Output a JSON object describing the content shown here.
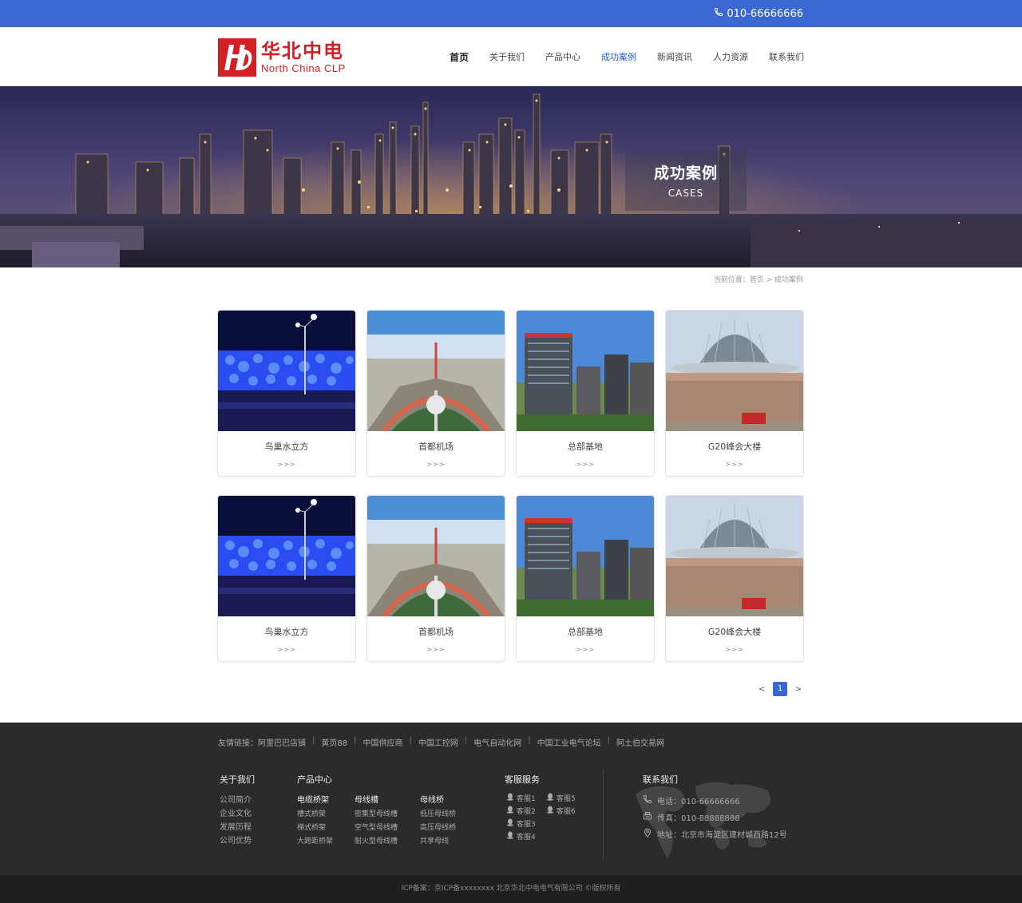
{
  "topbar": {
    "phone": "010-66666666",
    "phone_icon": "phone-icon"
  },
  "header": {
    "logo_cn": "华北中电",
    "logo_en": "North China CLP",
    "nav": [
      "首页",
      "关于我们",
      "产品中心",
      "成功案例",
      "新闻资讯",
      "人力资源",
      "联系我们"
    ]
  },
  "banner": {
    "title": "成功案例",
    "subtitle": "CASES"
  },
  "breadcrumb": {
    "text": "当前位置：首页 > 成功案例"
  },
  "cases": [
    {
      "name": "鸟巢水立方",
      "more": ">>>"
    },
    {
      "name": "首都机场",
      "more": ">>>"
    },
    {
      "name": "总部基地",
      "more": ">>>"
    },
    {
      "name": "G20峰会大楼",
      "more": ">>>"
    },
    {
      "name": "鸟巢水立方",
      "more": ">>>"
    },
    {
      "name": "首都机场",
      "more": ">>>"
    },
    {
      "name": "总部基地",
      "more": ">>>"
    },
    {
      "name": "G20峰会大楼",
      "more": ">>>"
    }
  ],
  "pager": {
    "prev": "<",
    "current": "1",
    "next": ">"
  },
  "footer": {
    "links_label": "友情链接：",
    "links": [
      "阿里巴巴店铺",
      "黄页88",
      "中国供应商",
      "中国工控网",
      "电气自动化网",
      "中国工业电气论坛",
      "阿土伯交易网"
    ],
    "about": {
      "title": "关于我们",
      "items": [
        "公司简介",
        "企业文化",
        "发展历程",
        "公司优势"
      ]
    },
    "products": {
      "title": "产品中心",
      "groups": [
        {
          "title": "电缆桥架",
          "items": [
            "槽式桥架",
            "梯式桥架",
            "大跨距桥架"
          ]
        },
        {
          "title": "母线槽",
          "items": [
            "密集型母线槽",
            "空气型母线槽",
            "耐火型母线槽"
          ]
        },
        {
          "title": "母线桥",
          "items": [
            "低压母线桥",
            "高压母线桥",
            "共享母线"
          ]
        }
      ]
    },
    "service": {
      "title": "客服服务",
      "items": [
        "客服1",
        "客服5",
        "客服2",
        "客服6",
        "客服3",
        "",
        "客服4",
        ""
      ]
    },
    "contact": {
      "title": "联系我们",
      "phone": "电话：010-66666666",
      "fax": "传真：010-88888888",
      "address": "地址：北京市海淀区建材城西路12号"
    },
    "copyright": "ICP备案：京ICP备xxxxxxxx 北京华北中电电气有限公司 ©版权所有"
  },
  "colors": {
    "brand_blue": "#3b68d0",
    "logo_red": "#d11f25",
    "footer_bg": "#2b2b2b"
  }
}
